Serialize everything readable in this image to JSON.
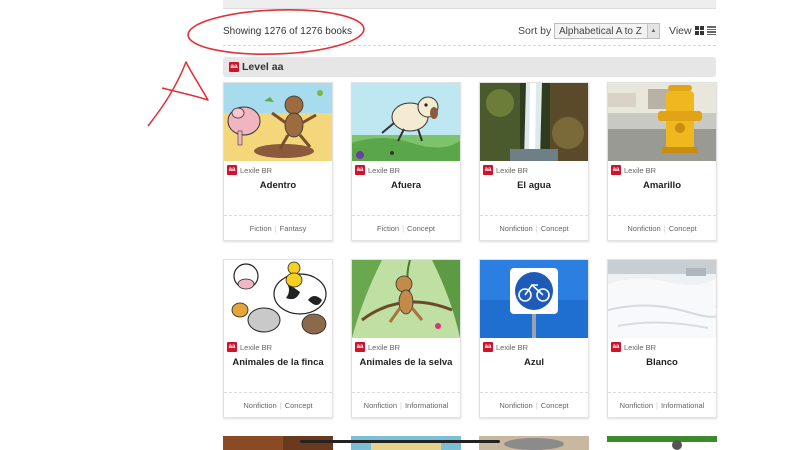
{
  "results": {
    "showing": "Showing 1276 of 1276 books",
    "sort_label": "Sort by",
    "sort_value": "Alphabetical  A to Z",
    "view_label": "View"
  },
  "level": {
    "badge": "aa",
    "title": "Level aa"
  },
  "books": [
    {
      "title": "Adentro",
      "badge": "aa",
      "lexile": "Lexile BR",
      "tags": [
        "Fiction",
        "Fantasy"
      ],
      "image": "cartoon-pig-monkey"
    },
    {
      "title": "Afuera",
      "badge": "aa",
      "lexile": "Lexile BR",
      "tags": [
        "Fiction",
        "Concept"
      ],
      "image": "cartoon-dog-outdoors"
    },
    {
      "title": "El agua",
      "badge": "aa",
      "lexile": "Lexile BR",
      "tags": [
        "Nonfiction",
        "Concept"
      ],
      "image": "waterfall-photo"
    },
    {
      "title": "Amarillo",
      "badge": "aa",
      "lexile": "Lexile BR",
      "tags": [
        "Nonfiction",
        "Concept"
      ],
      "image": "yellow-hydrant-photo"
    },
    {
      "title": "Animales de la finca",
      "badge": "aa",
      "lexile": "Lexile BR",
      "tags": [
        "Nonfiction",
        "Concept"
      ],
      "image": "farm-animals-drawing"
    },
    {
      "title": "Animales de la selva",
      "badge": "aa",
      "lexile": "Lexile BR",
      "tags": [
        "Nonfiction",
        "Informational"
      ],
      "image": "jungle-monkey-drawing"
    },
    {
      "title": "Azul",
      "badge": "aa",
      "lexile": "Lexile BR",
      "tags": [
        "Nonfiction",
        "Concept"
      ],
      "image": "blue-bike-sign-photo"
    },
    {
      "title": "Blanco",
      "badge": "aa",
      "lexile": "Lexile BR",
      "tags": [
        "Nonfiction",
        "Informational"
      ],
      "image": "snow-photo"
    }
  ],
  "colors": {
    "badge": "#d1122b",
    "annotation": "#e0303a",
    "level_bar": "#e6e6e6"
  }
}
